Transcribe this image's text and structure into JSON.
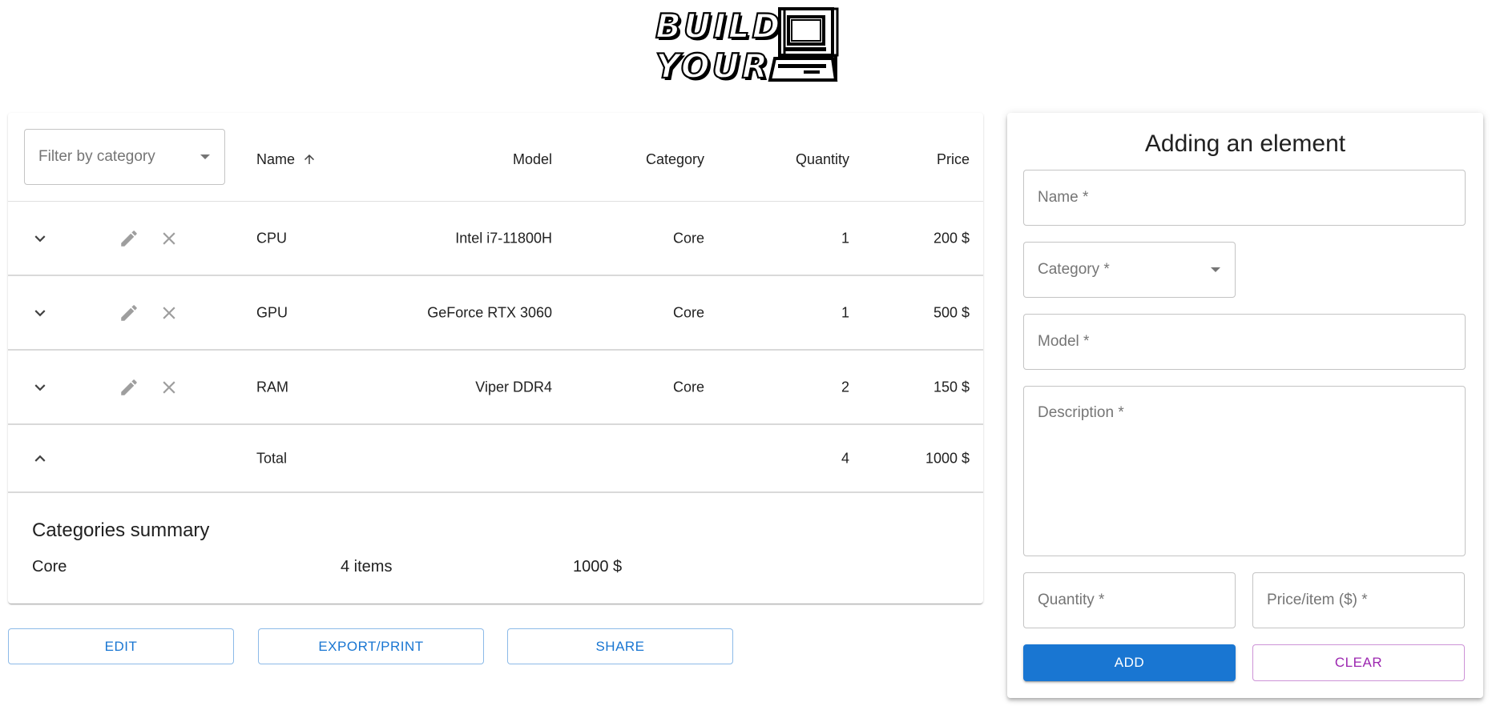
{
  "logo": {
    "line1": "BUILD",
    "line2": "YOUR",
    "icon": "retro-computer-icon"
  },
  "table": {
    "filter": {
      "placeholder": "Filter by category"
    },
    "headers": {
      "name": "Name",
      "model": "Model",
      "category": "Category",
      "quantity": "Quantity",
      "price": "Price"
    },
    "sort": {
      "column": "name",
      "direction": "ascending",
      "icon": "arrow-up-icon"
    },
    "rows": [
      {
        "name": "CPU",
        "model": "Intel i7-11800H",
        "category": "Core",
        "quantity": "1",
        "price": "200 $"
      },
      {
        "name": "GPU",
        "model": "GeForce RTX 3060",
        "category": "Core",
        "quantity": "1",
        "price": "500 $"
      },
      {
        "name": "RAM",
        "model": "Viper DDR4",
        "category": "Core",
        "quantity": "2",
        "price": "150 $"
      }
    ],
    "row_icons": [
      "chevron-down-icon",
      "pencil-icon",
      "close-icon"
    ],
    "total": {
      "label": "Total",
      "quantity": "4",
      "price": "1000 $",
      "icon": "chevron-up-icon"
    },
    "summary": {
      "title": "Categories summary",
      "items": [
        {
          "category": "Core",
          "count": "4 items",
          "total": "1000 $"
        }
      ]
    }
  },
  "actions": {
    "edit": "EDIT",
    "export": "EXPORT/PRINT",
    "share": "SHARE"
  },
  "form": {
    "title": "Adding an element",
    "name_label": "Name *",
    "category_label": "Category *",
    "model_label": "Model *",
    "description_label": "Description *",
    "quantity_label": "Quantity *",
    "price_label": "Price/item ($) *",
    "add": "ADD",
    "clear": "CLEAR"
  },
  "colors": {
    "primary": "#1976d2",
    "secondary": "#9c27b0",
    "icon_gray": "#9e9e9e",
    "text": "#212121",
    "placeholder": "#757575"
  }
}
